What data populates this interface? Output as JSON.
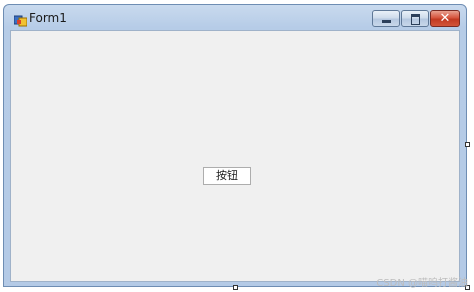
{
  "window": {
    "title": "Form1",
    "icon": "form-app-icon",
    "controls": {
      "minimize": "minimize-icon",
      "maximize": "maximize-icon",
      "close": "close-icon",
      "close_glyph": "✕"
    }
  },
  "form": {
    "button_label": "按钮"
  },
  "watermark": "CSDN @喵呜打酱油",
  "colors": {
    "client_background": "#f0f0f0",
    "frame": "#b4cae6",
    "close_button": "#c23a22"
  }
}
